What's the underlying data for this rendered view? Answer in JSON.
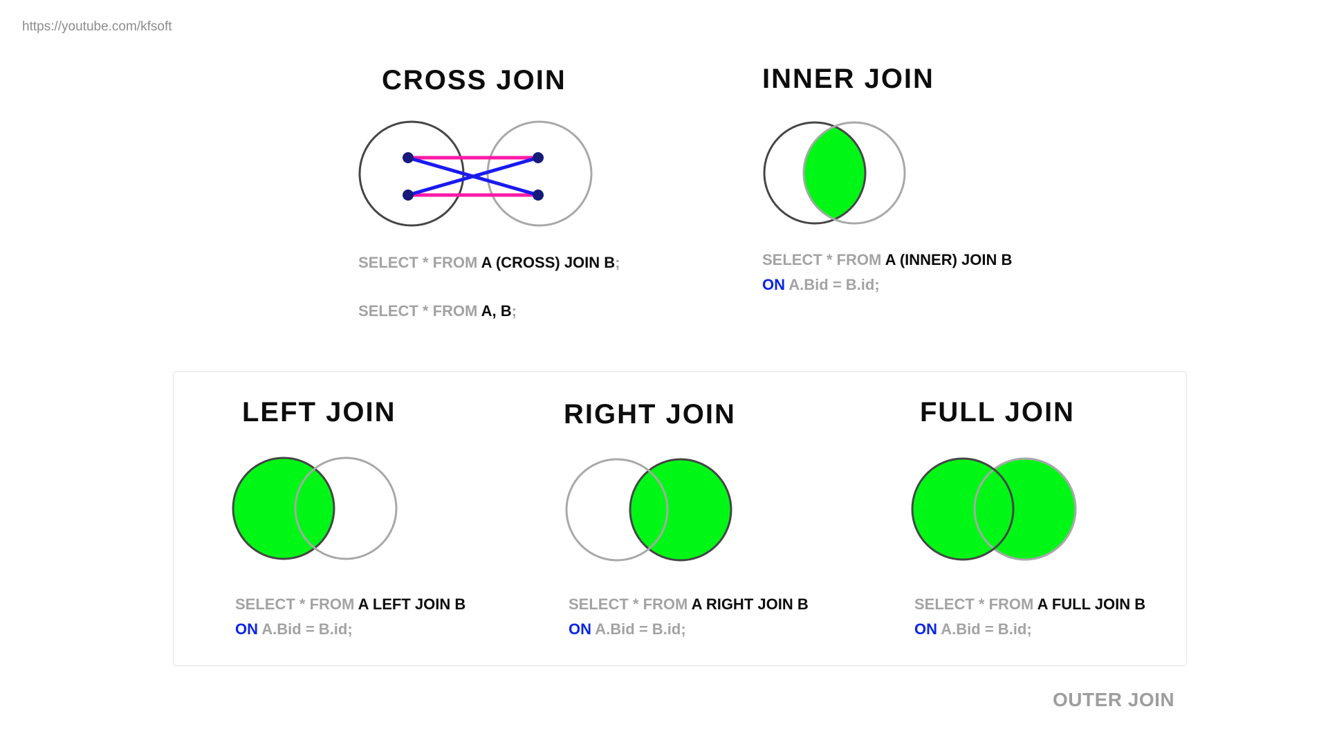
{
  "header": {
    "url": "https://youtube.com/kfsoft"
  },
  "colors": {
    "fill": "#00f716",
    "circle_a": "#454545",
    "circle_b": "#a8a8a8",
    "line_blue": "#1a1aef",
    "line_pink": "#ff1aa6",
    "dot": "#161a7a",
    "keyword_on": "#0a24e6",
    "code_gray": "#a3a3a3"
  },
  "cross": {
    "title": "CROSS  JOIN",
    "q1": {
      "kw": "SELECT * FROM ",
      "tbl": "A (CROSS) JOIN B",
      "end": ";"
    },
    "q2": {
      "kw": "SELECT * FROM ",
      "tbl": "A, B",
      "end": ";"
    }
  },
  "inner": {
    "title": "INNER  JOIN",
    "line1": {
      "kw": "SELECT * FROM ",
      "tbl": "A (INNER) JOIN B"
    },
    "line2": {
      "on": "ON",
      "cond": " A.Bid = B.id;"
    }
  },
  "left": {
    "title": "LEFT  JOIN",
    "line1": {
      "kw": "SELECT * FROM ",
      "tbl": "A LEFT JOIN B"
    },
    "line2": {
      "on": "ON",
      "cond": " A.Bid = B.id;"
    }
  },
  "right": {
    "title": "RIGHT  JOIN",
    "line1": {
      "kw": "SELECT * FROM ",
      "tbl": "A RIGHT JOIN B"
    },
    "line2": {
      "on": "ON",
      "cond": " A.Bid = B.id;"
    }
  },
  "full": {
    "title": "FULL  JOIN",
    "line1": {
      "kw": "SELECT * FROM ",
      "tbl": "A FULL JOIN B"
    },
    "line2": {
      "on": "ON",
      "cond": " A.Bid = B.id;"
    }
  },
  "outer_label": "OUTER JOIN"
}
